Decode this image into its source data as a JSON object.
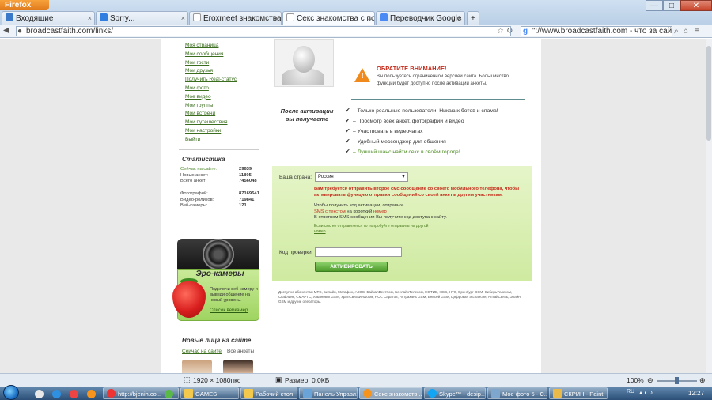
{
  "browser": {
    "app_name": "Firefox",
    "tabs": [
      {
        "label": "Входящие"
      },
      {
        "label": "Sorry..."
      },
      {
        "label": "Eroxmeet знакомства ..."
      },
      {
        "label": "Секс знакомства с по..."
      },
      {
        "label": "Переводчик Google"
      }
    ],
    "new_tab": "+",
    "url": "broadcastfaith.com/links/",
    "search_text": "\"://www.broadcastfaith.com - что за сайт?",
    "window_controls": {
      "minimize": "—",
      "maximize": "□",
      "close": "✕"
    }
  },
  "sidebar": {
    "menu": [
      "Моя страница",
      "Мои сообщения",
      "Мои гости",
      "Мои друзья",
      "Получить Real-статус",
      "Мои фото",
      "Мое видео",
      "Мои группы",
      "Мои встречи",
      "Мои путешествия",
      "Мои настройки",
      "Выйти"
    ],
    "stats_title": "Статистика",
    "stats": [
      {
        "label": "Сейчас на сайте:",
        "value": "29639"
      },
      {
        "label": "Новых анкет:",
        "value": "11805"
      },
      {
        "label": "Всего анкет:",
        "value": "7456048"
      },
      {
        "label": "Фотографий:",
        "value": "87169541"
      },
      {
        "label": "Видео-роликов:",
        "value": "719841"
      },
      {
        "label": "Веб-камеры:",
        "value": "121"
      }
    ],
    "webcam": {
      "title": "Эро-камеры",
      "text": "Подключи веб-камеру и выведи общение на новый уровень.",
      "link": "Список вебкамер"
    },
    "new_faces": {
      "title": "Новые лица на сайте",
      "tab_online": "Сейчас на сайте",
      "tab_all": "Все анкеты"
    }
  },
  "warning": {
    "title": "ОБРАТИТЕ ВНИМАНИЕ!",
    "text": "Вы пользуетесь ограниченной версией сайта. Большинство функций будет доступно после активации анкеты."
  },
  "benefits": {
    "title": "После активации вы получаете",
    "items": [
      "– Только реальные пользователи! Никаких ботов и спама!",
      "– Просмотр всех анкет, фотографий и видео",
      "– Участвовать в видеочатах",
      "– Удобный мессенджер для общения",
      "– Лучший шанс найти секс в своём городе!"
    ]
  },
  "activation": {
    "country_label": "Ваша страна:",
    "country_value": "Россия",
    "red_notice": "Вам требуется отправить второе смс-сообщение со своего мобильного телефона, чтобы активировать функцию отправки сообщений со своей анкеты другим участникам.",
    "instr_1": "Чтобы получить код активации, отправьте",
    "instr_sms": "SMS с текстом",
    "instr_mid": " на короткий ",
    "instr_number": "номер",
    "instr_2": "В ответном SMS сообщении Вы получите код доступа к сайту.",
    "hint": "Если смс не отправляется то попробуйте отправить на другой номер",
    "code_label": "Код проверки:",
    "button": "АКТИВИРОВАТЬ"
  },
  "operators_text": "Доступно абонентам МТС, Билайн, Мегафон, АКОС, БайкалВестКом, БеелайнТелеком, НОТИВ, НСС, НТК, Оренбург GSM, СибирьТелеком, Скайлинк, СМАРТС, Ульяновск GSM, УралСвязьИнформ, НСС Саратов, Астрахань GSM, Енисей GSM, Цифровая экспансия, АлтайСвязь, Элайн GSM и другие операторы.",
  "statusbar": {
    "dimensions": "1920 × 1080пкс",
    "size": "Размер: 0,0КБ",
    "zoom": "100%"
  },
  "taskbar": {
    "items": [
      {
        "label": "http://bjenih.co..."
      },
      {
        "label": "GAMES"
      },
      {
        "label": "Рабочий стол"
      },
      {
        "label": "Панель Управл..."
      },
      {
        "label": "Секс знакомств..."
      },
      {
        "label": "Skype™ - desip..."
      },
      {
        "label": "Мое фото 5 - С..."
      },
      {
        "label": "СКРИН - Paint"
      }
    ],
    "lang": "RU",
    "time": "12:27"
  },
  "colors": {
    "accent_green": "#4e8a2c",
    "warning_red": "#c52b1a",
    "form_bg": "#d8efb1"
  }
}
